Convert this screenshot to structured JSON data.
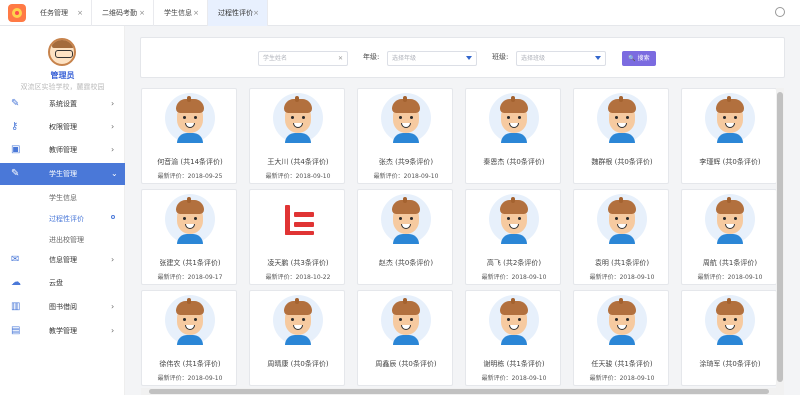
{
  "tabs": [
    {
      "label": "任务管理"
    },
    {
      "label": "二维码考勤"
    },
    {
      "label": "学生信息"
    },
    {
      "label": "过程性评价"
    }
  ],
  "tab_close": "×",
  "sidebar": {
    "admin_name": "管理员",
    "school": "双流区实验学校，麓霆校园",
    "items": [
      {
        "label": "系统设置",
        "icon": "wrench-icon"
      },
      {
        "label": "权限管理",
        "icon": "key-icon"
      },
      {
        "label": "教师管理",
        "icon": "briefcase-icon"
      },
      {
        "label": "学生管理",
        "icon": "pencil-icon"
      },
      {
        "label": "信息管理",
        "icon": "mail-icon"
      },
      {
        "label": "云盘",
        "icon": "cloud-icon"
      },
      {
        "label": "图书借阅",
        "icon": "book-icon"
      },
      {
        "label": "教学管理",
        "icon": "card-icon"
      }
    ],
    "sub_items": [
      {
        "label": "学生信息"
      },
      {
        "label": "过程性评价"
      },
      {
        "label": "进出校管理"
      }
    ]
  },
  "search": {
    "name_placeholder": "学生姓名",
    "name_clear": "✕",
    "grade_label": "年级:",
    "grade_placeholder": "选择年级",
    "class_label": "班级:",
    "class_placeholder": "选择班级",
    "button_label": "🔍 搜索"
  },
  "students": [
    {
      "name": "何音渝 (共14条评价)",
      "date": "最新评价：2018-09-25"
    },
    {
      "name": "王大川 (共4条评价)",
      "date": "最新评价：2018-09-10"
    },
    {
      "name": "张杰 (共9条评价)",
      "date": "最新评价：2018-09-10"
    },
    {
      "name": "秦恩杰 (共0条评价)",
      "date": ""
    },
    {
      "name": "魏群根 (共0条评价)",
      "date": ""
    },
    {
      "name": "李瑾辉 (共0条评价)",
      "date": ""
    },
    {
      "name": "张建文 (共1条评价)",
      "date": "最新评价：2018-09-17"
    },
    {
      "name": "凌天鹏 (共3条评价)",
      "date": "最新评价：2018-10-22"
    },
    {
      "name": "赵杰 (共0条评价)",
      "date": ""
    },
    {
      "name": "高飞 (共2条评价)",
      "date": "最新评价：2018-09-10"
    },
    {
      "name": "袁明 (共1条评价)",
      "date": "最新评价：2018-09-10"
    },
    {
      "name": "周航 (共1条评价)",
      "date": "最新评价：2018-09-10"
    },
    {
      "name": "徐伟农 (共1条评价)",
      "date": "最新评价：2018-09-10"
    },
    {
      "name": "周晴康 (共0条评价)",
      "date": ""
    },
    {
      "name": "周鑫辰 (共0条评价)",
      "date": ""
    },
    {
      "name": "谢明栋 (共1条评价)",
      "date": "最新评价：2018-09-10"
    },
    {
      "name": "任天骏 (共1条评价)",
      "date": "最新评价：2018-09-10"
    },
    {
      "name": "涂琦军 (共0条评价)",
      "date": ""
    }
  ]
}
